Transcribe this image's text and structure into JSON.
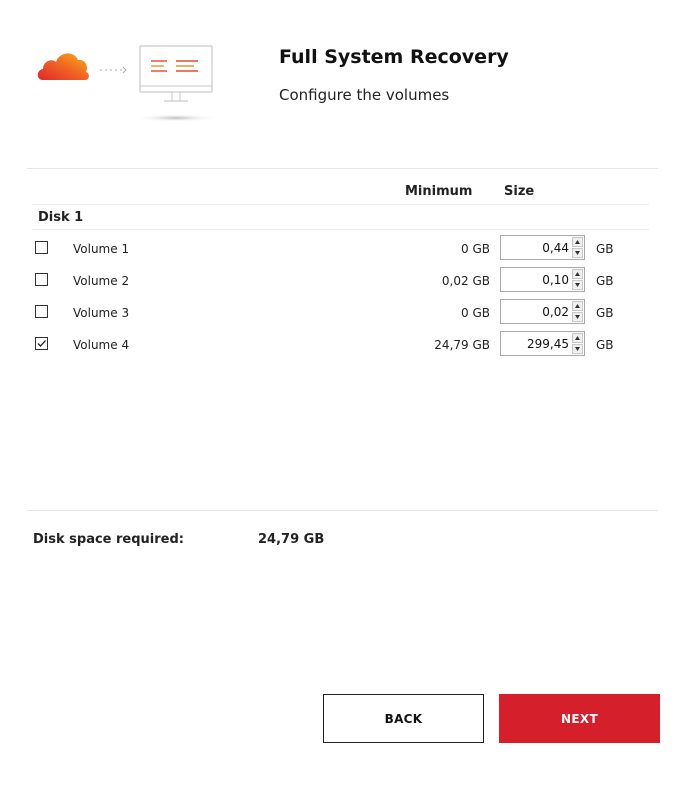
{
  "header": {
    "title": "Full System Recovery",
    "subtitle": "Configure the volumes",
    "illustration": [
      "cloud-icon",
      "monitor-icon"
    ],
    "accent_color": "#d5202b"
  },
  "table": {
    "columns": {
      "minimum": "Minimum",
      "size": "Size"
    },
    "disk_label": "Disk 1",
    "rows": [
      {
        "checked": false,
        "name": "Volume 1",
        "minimum": "0 GB",
        "size": "0,44",
        "unit": "GB"
      },
      {
        "checked": false,
        "name": "Volume 2",
        "minimum": "0,02 GB",
        "size": "0,10",
        "unit": "GB"
      },
      {
        "checked": false,
        "name": "Volume 3",
        "minimum": "0 GB",
        "size": "0,02",
        "unit": "GB"
      },
      {
        "checked": true,
        "name": "Volume 4",
        "minimum": "24,79 GB",
        "size": "299,45",
        "unit": "GB"
      }
    ]
  },
  "summary": {
    "label": "Disk space required:",
    "value": "24,79 GB"
  },
  "buttons": {
    "back": "BACK",
    "next": "NEXT"
  }
}
